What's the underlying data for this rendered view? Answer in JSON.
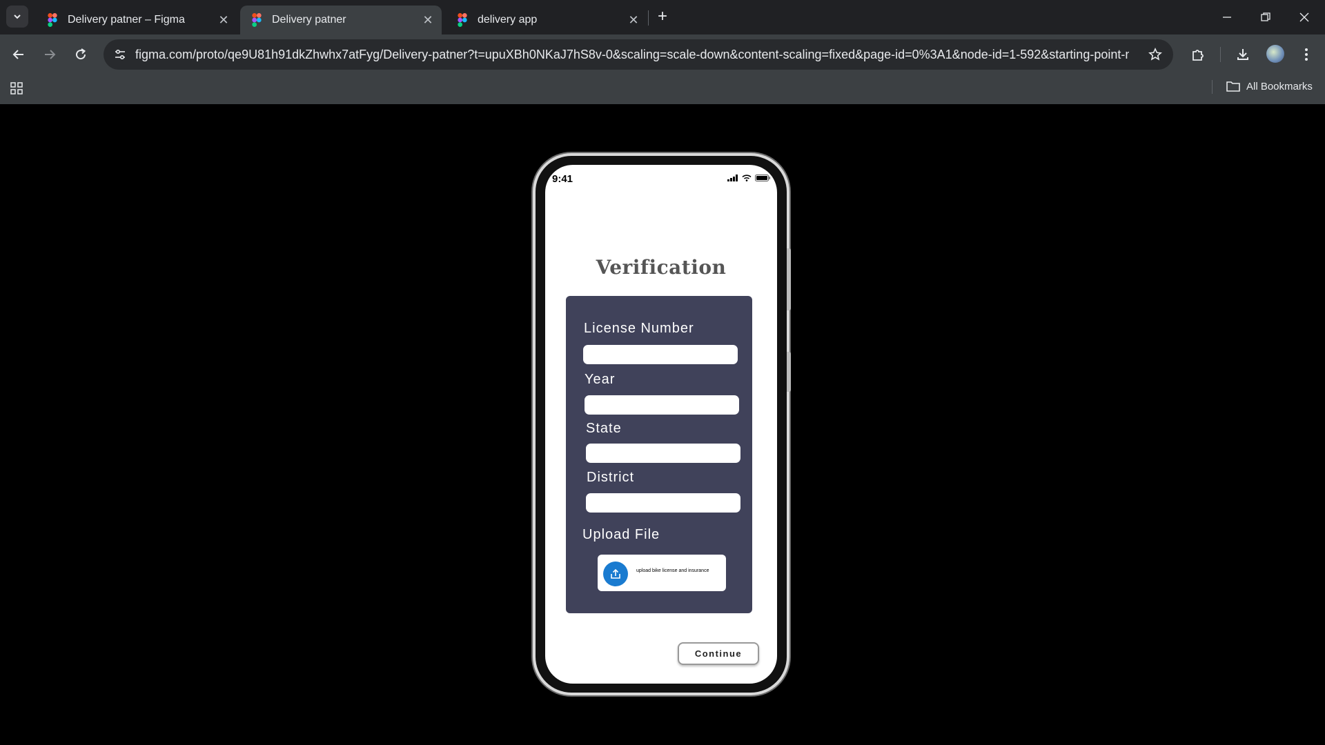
{
  "browser": {
    "tabs": [
      {
        "title": "Delivery patner – Figma",
        "active": false
      },
      {
        "title": "Delivery patner",
        "active": true
      },
      {
        "title": "delivery app",
        "active": false
      }
    ],
    "url": "figma.com/proto/qe9U81h91dkZhwhx7atFyg/Delivery-patner?t=upuXBh0NKaJ7hS8v-0&scaling=scale-down&content-scaling=fixed&page-id=0%3A1&node-id=1-592&starting-point-n...",
    "bookmarks_label": "All Bookmarks"
  },
  "phone": {
    "status_time": "9:41",
    "title": "Verification",
    "fields": [
      {
        "label": "License Number",
        "value": ""
      },
      {
        "label": "Year",
        "value": ""
      },
      {
        "label": "State",
        "value": ""
      },
      {
        "label": "District",
        "value": ""
      }
    ],
    "upload": {
      "label": "Upload File",
      "button_text": "upload bike license and insurance"
    },
    "continue_label": "Continue"
  },
  "colors": {
    "card": "#40425a",
    "upload_icon": "#1a7bd0",
    "tabstrip": "#202124",
    "toolbar": "#3c4043"
  }
}
